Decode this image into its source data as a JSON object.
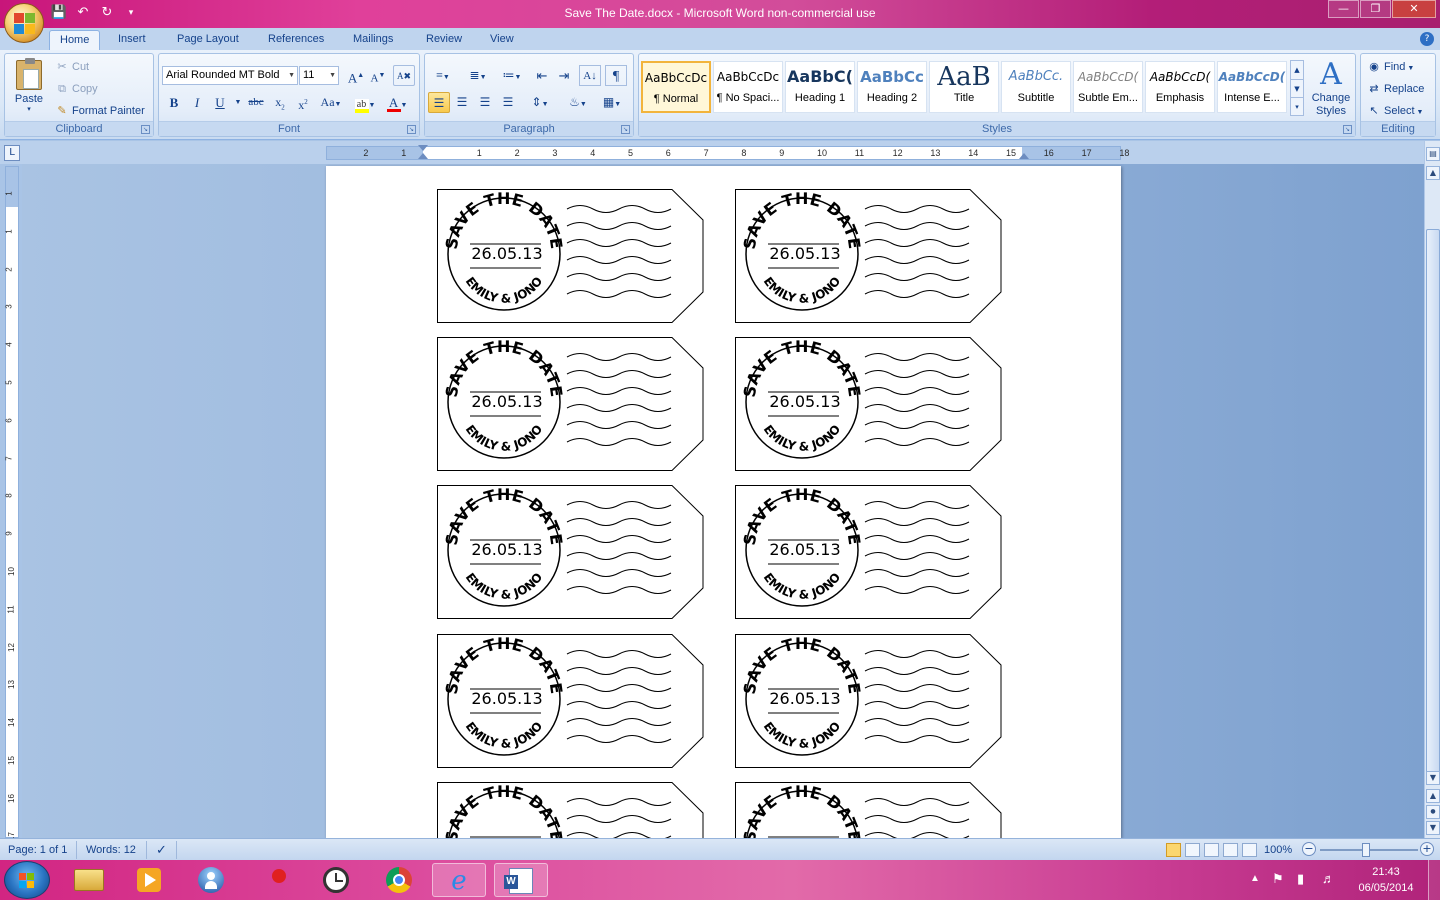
{
  "window": {
    "title": "Save The Date.docx - Microsoft Word non-commercial use"
  },
  "ribbon_tabs": [
    "Home",
    "Insert",
    "Page Layout",
    "References",
    "Mailings",
    "Review",
    "View"
  ],
  "clipboard": {
    "paste": "Paste",
    "cut": "Cut",
    "copy": "Copy",
    "format_painter": "Format Painter",
    "label": "Clipboard"
  },
  "font": {
    "name": "Arial Rounded MT Bold",
    "size": "11",
    "label": "Font"
  },
  "paragraph": {
    "label": "Paragraph"
  },
  "styles": {
    "label": "Styles",
    "items": [
      {
        "sample": "AaBbCcDc",
        "name": "¶ Normal"
      },
      {
        "sample": "AaBbCcDc",
        "name": "¶ No Spaci..."
      },
      {
        "sample": "AaBbC(",
        "name": "Heading 1"
      },
      {
        "sample": "AaBbCc",
        "name": "Heading 2"
      },
      {
        "sample": "AaB",
        "name": "Title"
      },
      {
        "sample": "AaBbCc.",
        "name": "Subtitle"
      },
      {
        "sample": "AaBbCcD(",
        "name": "Subtle Em..."
      },
      {
        "sample": "AaBbCcD(",
        "name": "Emphasis"
      },
      {
        "sample": "AaBbCcD(",
        "name": "Intense E..."
      }
    ],
    "change_styles": "Change Styles"
  },
  "editing": {
    "label": "Editing",
    "find": "Find",
    "replace": "Replace",
    "select": "Select"
  },
  "ruler": {
    "h_numbers": [
      "2",
      "1",
      "1",
      "2",
      "3",
      "4",
      "5",
      "6",
      "7",
      "8",
      "9",
      "10",
      "11",
      "12",
      "13",
      "14",
      "15",
      "16",
      "17",
      "18"
    ],
    "v_numbers": [
      "1",
      "1",
      "2",
      "3",
      "4",
      "5",
      "6",
      "7",
      "8",
      "9",
      "10",
      "11",
      "12",
      "13",
      "14",
      "15",
      "16",
      "17"
    ]
  },
  "document": {
    "tag_top_text": "SAVE THE DATE",
    "tag_date": "26.05.13",
    "tag_bottom_text": "EMILY & JONO"
  },
  "status": {
    "page": "Page: 1 of 1",
    "words": "Words: 12",
    "zoom": "100%"
  },
  "taskbar": {
    "time": "21:43",
    "date": "06/05/2014"
  }
}
